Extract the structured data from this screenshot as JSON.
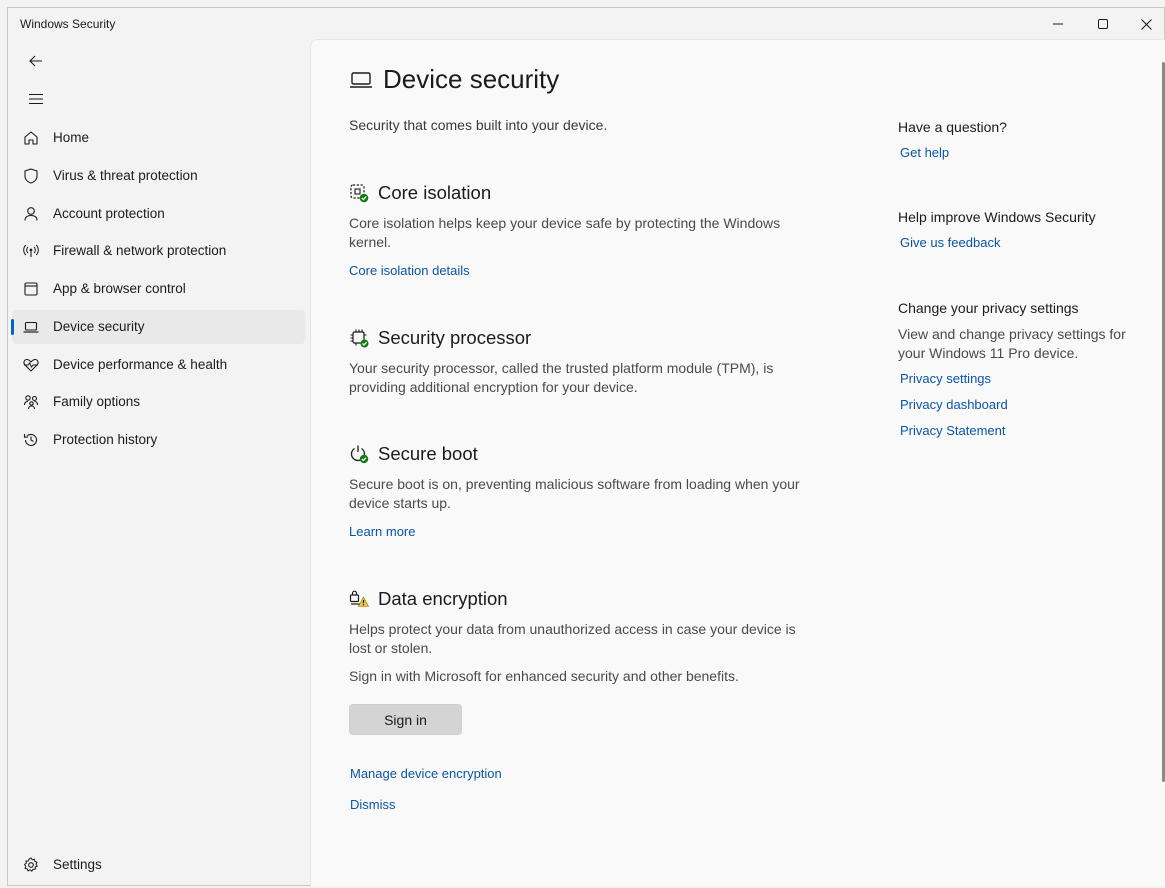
{
  "window": {
    "title": "Windows Security",
    "controls": [
      "minimize-icon",
      "maximize-icon",
      "close-icon"
    ]
  },
  "nav": {
    "back_icon": "back-arrow-icon",
    "menu_icon": "hamburger-icon",
    "items": [
      {
        "id": "home",
        "label": "Home",
        "icon": "home-icon"
      },
      {
        "id": "virus",
        "label": "Virus & threat protection",
        "icon": "shield-icon"
      },
      {
        "id": "account",
        "label": "Account protection",
        "icon": "person-icon"
      },
      {
        "id": "firewall",
        "label": "Firewall & network protection",
        "icon": "antenna-icon"
      },
      {
        "id": "app-browser",
        "label": "App & browser control",
        "icon": "app-window-icon"
      },
      {
        "id": "device-security",
        "label": "Device security",
        "icon": "laptop-icon",
        "active": true
      },
      {
        "id": "performance",
        "label": "Device performance & health",
        "icon": "heart-pulse-icon"
      },
      {
        "id": "family",
        "label": "Family options",
        "icon": "family-icon"
      },
      {
        "id": "history",
        "label": "Protection history",
        "icon": "history-icon"
      }
    ],
    "settings_label": "Settings"
  },
  "page": {
    "title": "Device security",
    "description": "Security that comes built into your device.",
    "sections": {
      "core_isolation": {
        "title": "Core isolation",
        "description": "Core isolation helps keep your device safe by protecting the Windows kernel.",
        "link": "Core isolation details"
      },
      "security_processor": {
        "title": "Security processor",
        "description": "Your security processor, called the trusted platform module (TPM), is providing additional encryption for your device."
      },
      "secure_boot": {
        "title": "Secure boot",
        "description": "Secure boot is on, preventing malicious software from loading when your device starts up.",
        "link": "Learn more"
      },
      "data_encryption": {
        "title": "Data encryption",
        "description": "Helps protect your data from unauthorized access in case your device is lost or stolen.",
        "signin_note": "Sign in with Microsoft for enhanced security and other benefits.",
        "signin_button": "Sign in",
        "manage_link": "Manage device encryption",
        "dismiss_link": "Dismiss"
      }
    }
  },
  "aside": {
    "question": {
      "heading": "Have a question?",
      "link": "Get help"
    },
    "improve": {
      "heading": "Help improve Windows Security",
      "link": "Give us feedback"
    },
    "privacy": {
      "heading": "Change your privacy settings",
      "text": "View and change privacy settings for your Windows 11 Pro device.",
      "links": [
        "Privacy settings",
        "Privacy dashboard",
        "Privacy Statement"
      ]
    }
  },
  "colors": {
    "accent": "#0067c0",
    "link": "#0a55a6",
    "status_ok": "#107c10",
    "warning": "#f2c744"
  }
}
